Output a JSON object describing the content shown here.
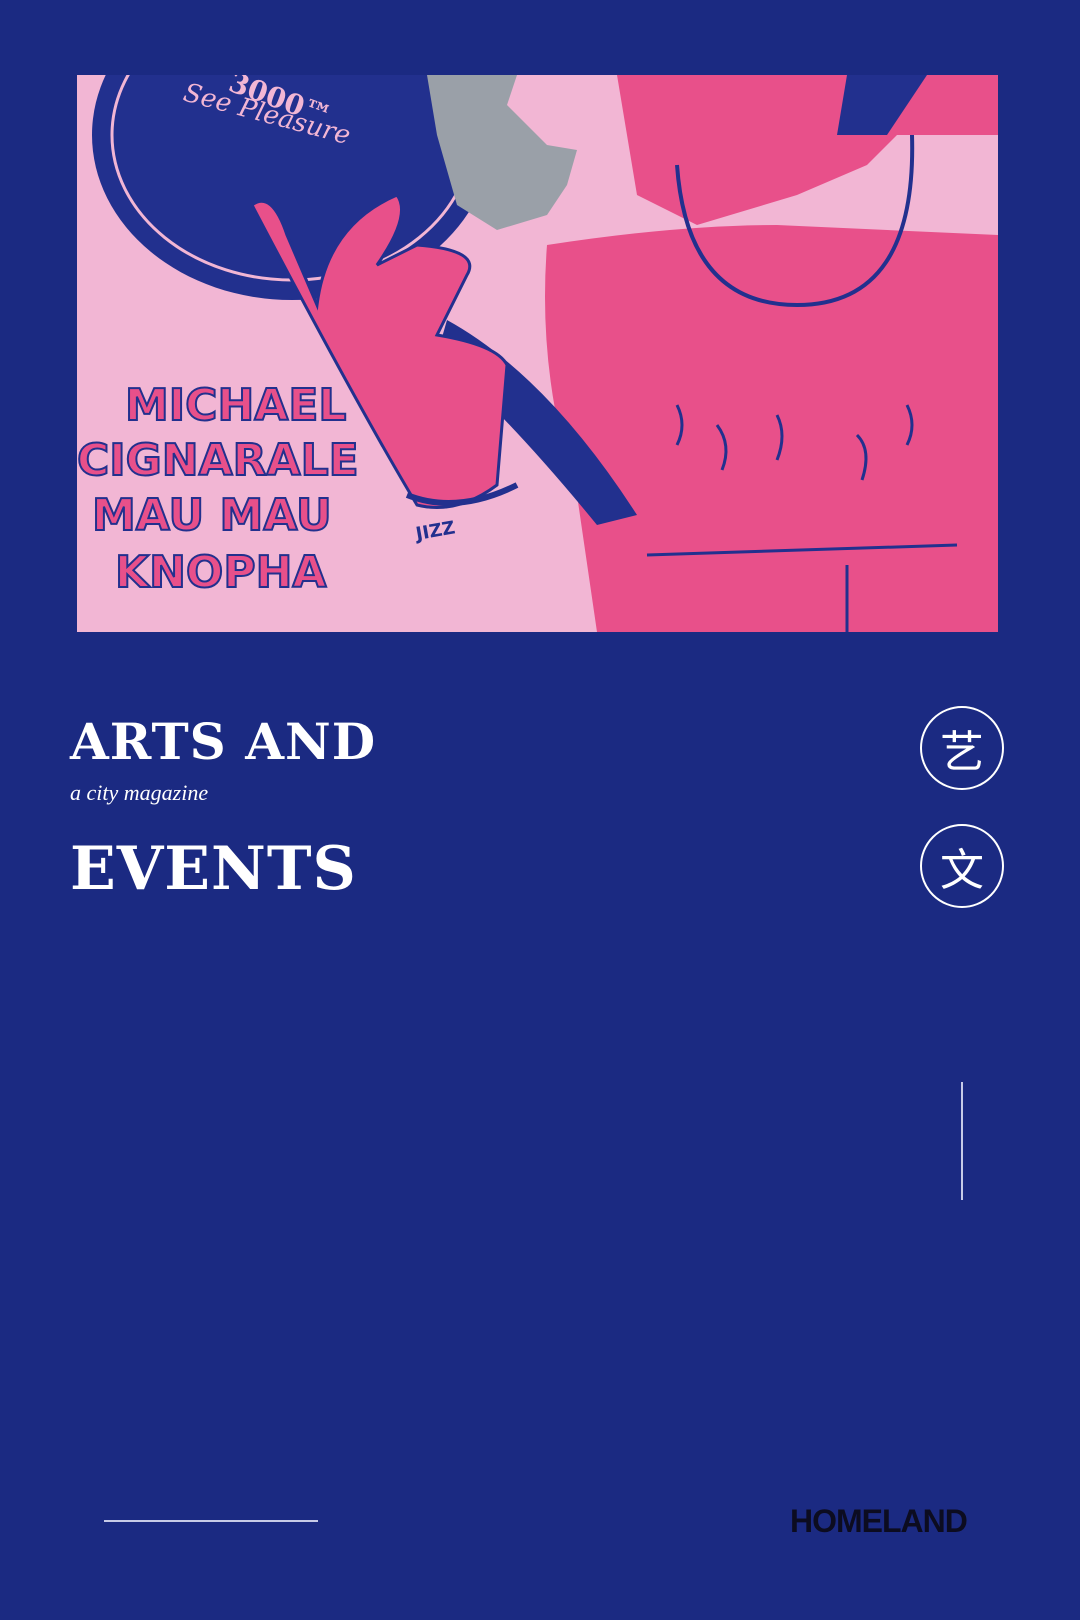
{
  "poster": {
    "script_text_top": "3000™",
    "script_text_bottom": "See Pleasure",
    "artists": [
      "MICHAEL",
      "CIGNARALE",
      "MAU MAU",
      "KNOPHA"
    ],
    "bracelet_text": "JIZZ"
  },
  "cover": {
    "title_line1": "ARTS AND",
    "tagline": "a city magazine",
    "title_line2": "EVENTS",
    "char_badges": [
      "艺",
      "文"
    ],
    "brand": "HOMELAND"
  },
  "colors": {
    "background": "#1b2a82",
    "poster_pink": "#f2b6d4",
    "figure_pink": "#e8508a",
    "navy": "#22308e"
  }
}
